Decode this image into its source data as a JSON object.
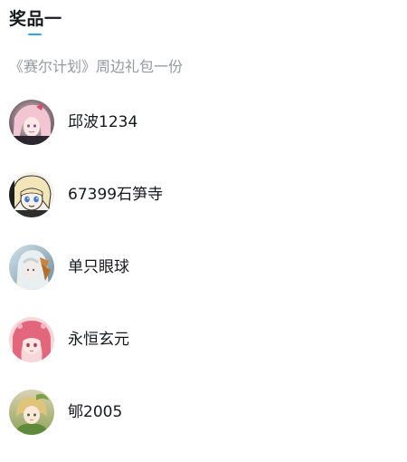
{
  "prize": {
    "title": "奖品一",
    "description": "《赛尔计划》周边礼包一份",
    "accent_color": "#2ba9de"
  },
  "winners": [
    {
      "name": "邱波1234",
      "avatar_icon": "anime-girl-pink-hair-avatar"
    },
    {
      "name": "67399石笋寺",
      "avatar_icon": "chibi-blonde-character-avatar"
    },
    {
      "name": "单只眼球",
      "avatar_icon": "white-haired-character-avatar"
    },
    {
      "name": "永恒玄元",
      "avatar_icon": "anime-girl-red-hair-avatar"
    },
    {
      "name": "郇2005",
      "avatar_icon": "anime-girl-green-outfit-avatar"
    }
  ]
}
